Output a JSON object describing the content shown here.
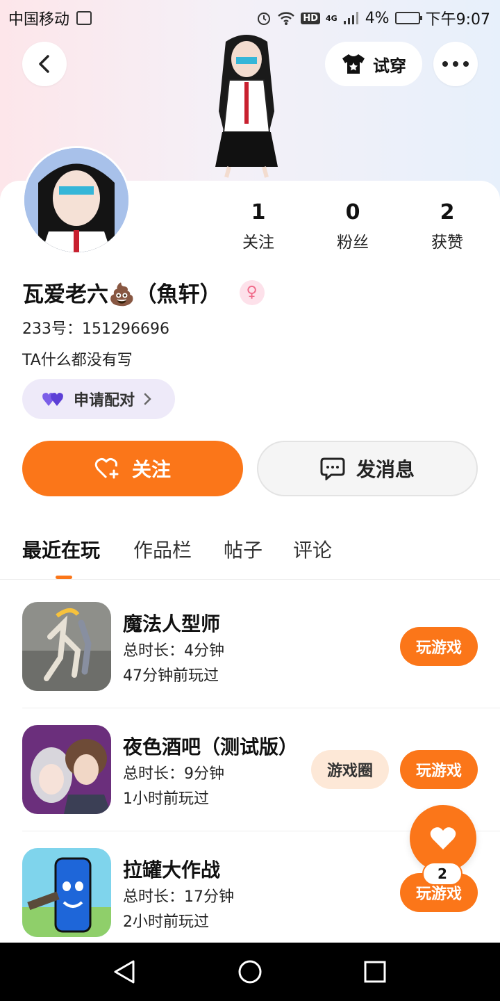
{
  "status_bar": {
    "carrier": "中国移动",
    "network": "4G",
    "hd": "HD",
    "battery": "4%",
    "time": "下午9:07"
  },
  "header": {
    "try_on_label": "试穿"
  },
  "stats": [
    {
      "value": "1",
      "label": "关注"
    },
    {
      "value": "0",
      "label": "粉丝"
    },
    {
      "value": "2",
      "label": "获赞"
    }
  ],
  "profile": {
    "username": "瓦爱老六💩（魚轩）",
    "uid": "233号：151296696",
    "bio": "TA什么都没有写",
    "pair_label": "申请配对"
  },
  "actions": {
    "follow_label": "关注",
    "message_label": "发消息"
  },
  "tabs": [
    "最近在玩",
    "作品栏",
    "帖子",
    "评论"
  ],
  "games": [
    {
      "title": "魔法人型师",
      "total_time": "总时长：4分钟",
      "last_played": "47分钟前玩过",
      "play_label": "玩游戏"
    },
    {
      "title": "夜色酒吧（测试版）",
      "total_time": "总时长：9分钟",
      "last_played": "1小时前玩过",
      "play_label": "玩游戏",
      "circle_label": "游戏圈"
    },
    {
      "title": "拉罐大作战",
      "total_time": "总时长：17分钟",
      "last_played": "2小时前玩过",
      "play_label": "玩游戏"
    }
  ],
  "like_fab": {
    "count": "2"
  },
  "colors": {
    "accent": "#fb7619",
    "pair_bg": "#eeeaf9",
    "gender": "#f06b8a"
  }
}
